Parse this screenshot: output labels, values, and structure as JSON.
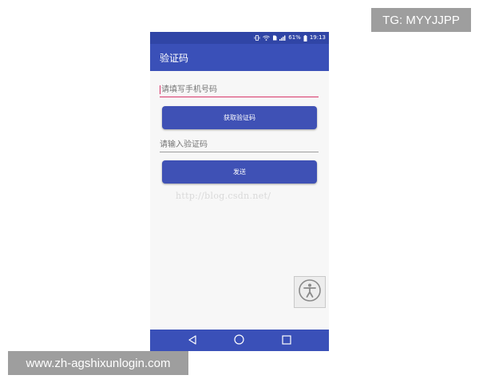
{
  "status_bar": {
    "battery_percent": "61%",
    "time": "19:13",
    "icons": [
      "vibrate-icon",
      "wifi-icon",
      "sim-icon",
      "signal-icon",
      "battery-icon"
    ]
  },
  "app_bar": {
    "title": "验证码"
  },
  "form": {
    "phone_placeholder": "请填写手机号码",
    "get_code_label": "获取验证码",
    "code_placeholder": "请输入验证码",
    "send_label": "发送"
  },
  "watermark": {
    "url": "http://blog.csdn.net/"
  },
  "nav_bar": {
    "icons": [
      "back-icon",
      "home-icon",
      "recents-icon"
    ]
  },
  "overlays": {
    "tg": "TG: MYYJJPP",
    "site": "www.zh-agshixunlogin.com"
  },
  "colors": {
    "primary": "#3f51b5",
    "primary_dark": "#3045a6",
    "accent": "#d8366a"
  }
}
